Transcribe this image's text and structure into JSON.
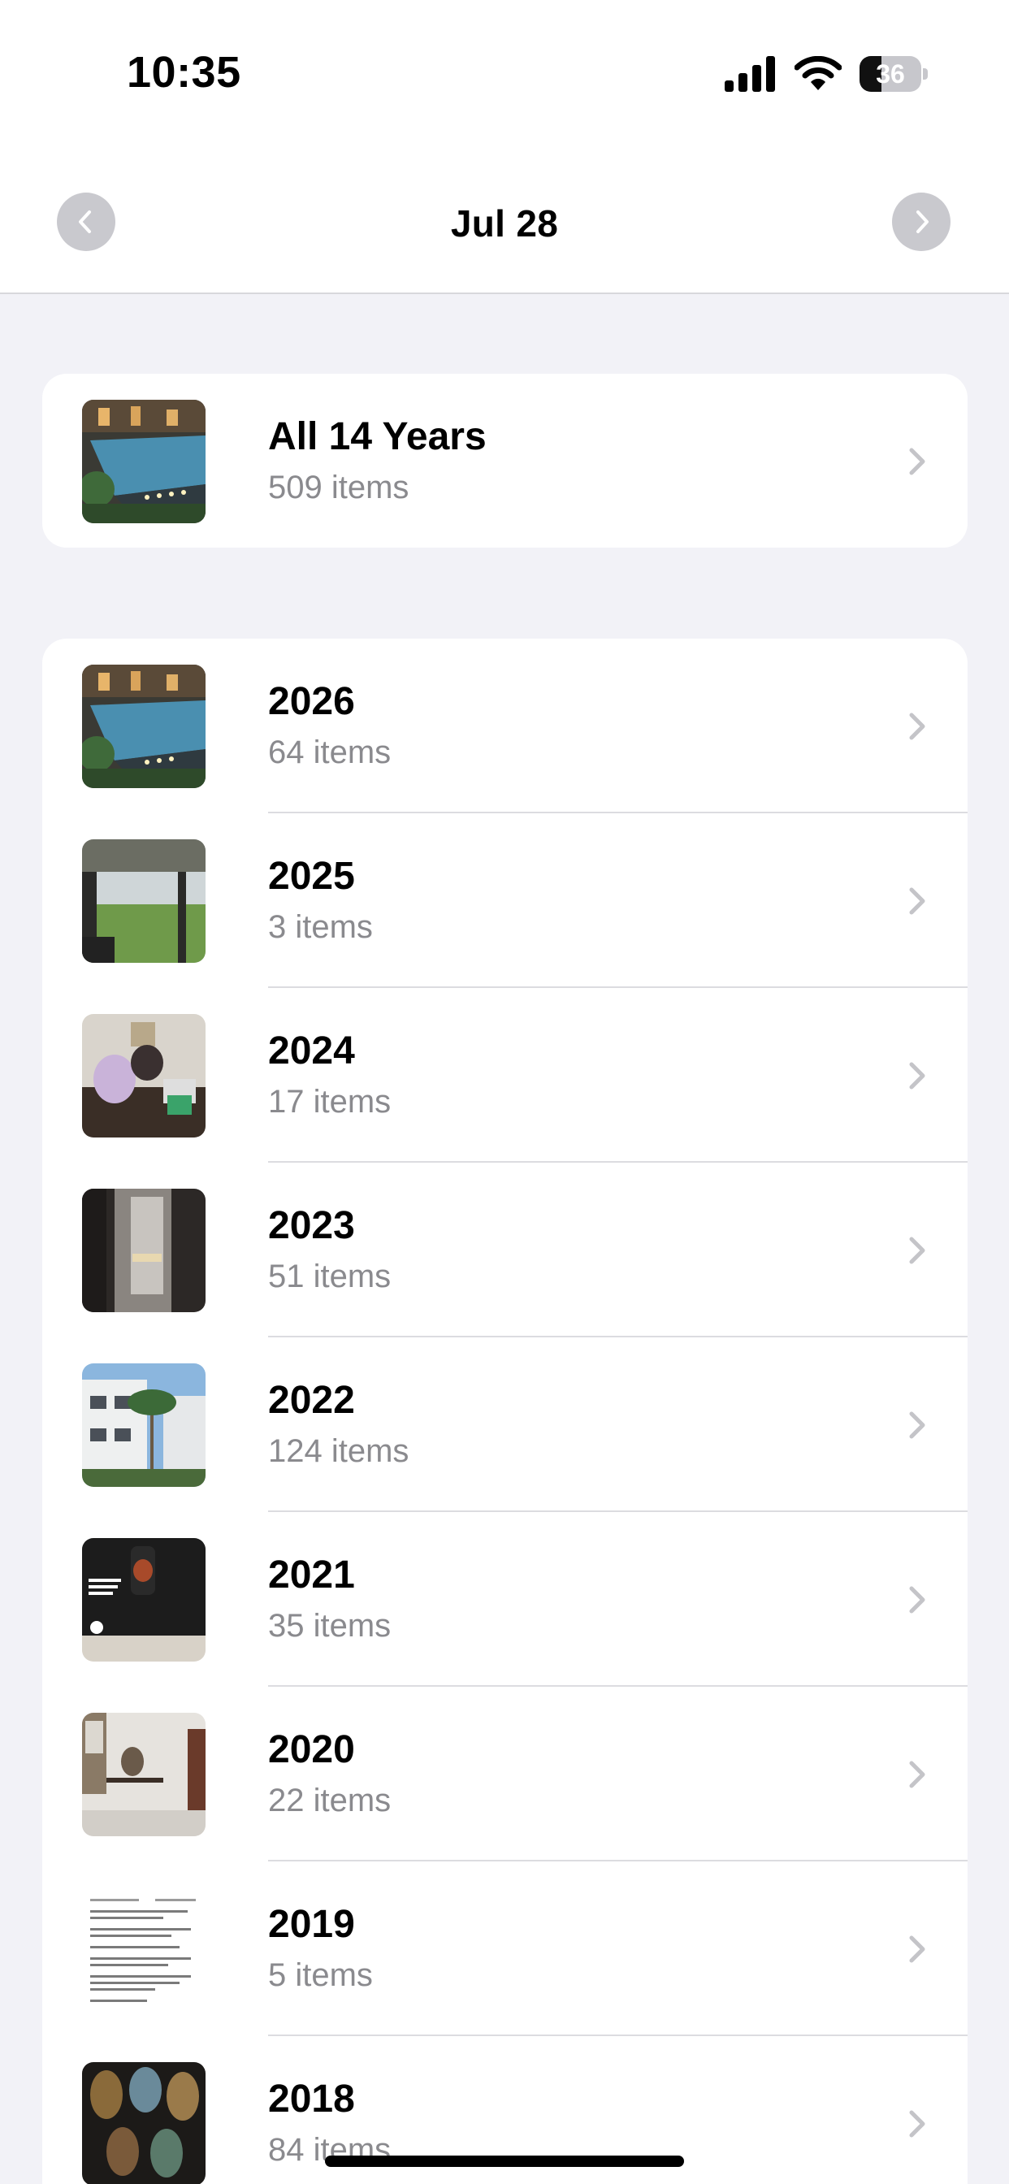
{
  "status_bar": {
    "time": "10:35",
    "battery_level": "36",
    "battery_fraction": 0.36,
    "icons": [
      "signal-icon",
      "wifi-icon",
      "battery-icon"
    ]
  },
  "header": {
    "title": "Jul 28",
    "prev_icon": "chevron-left-icon",
    "next_icon": "chevron-right-icon"
  },
  "all_years": {
    "title": "All 14 Years",
    "subtitle": "509 items"
  },
  "years": [
    {
      "title": "2026",
      "subtitle": "64 items"
    },
    {
      "title": "2025",
      "subtitle": "3 items"
    },
    {
      "title": "2024",
      "subtitle": "17 items"
    },
    {
      "title": "2023",
      "subtitle": "51 items"
    },
    {
      "title": "2022",
      "subtitle": "124 items"
    },
    {
      "title": "2021",
      "subtitle": "35 items"
    },
    {
      "title": "2020",
      "subtitle": "22 items"
    },
    {
      "title": "2019",
      "subtitle": "5 items"
    },
    {
      "title": "2018",
      "subtitle": "84 items"
    }
  ],
  "colors": {
    "background": "#f2f2f7",
    "secondary_text": "#8a8a8e",
    "chevron": "#c4c4c8"
  }
}
